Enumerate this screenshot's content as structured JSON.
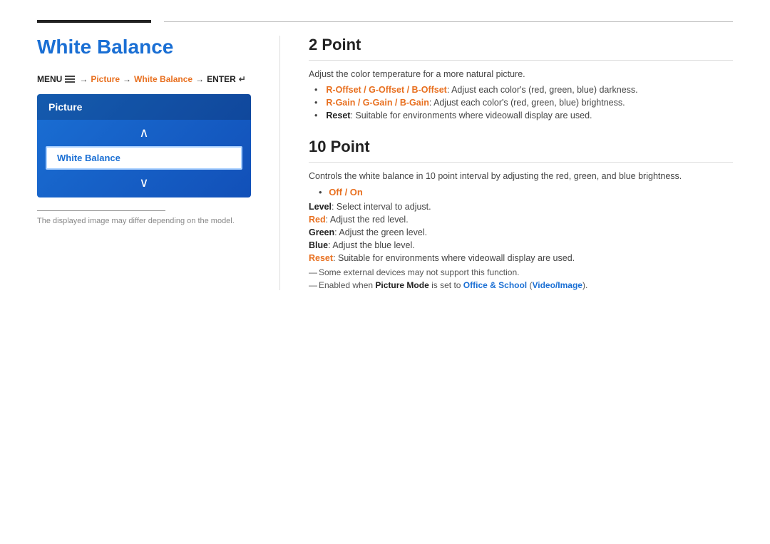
{
  "topbar": {
    "short_line": true,
    "long_line": true
  },
  "left": {
    "title": "White Balance",
    "menu_path": {
      "menu_label": "MENU",
      "arrow1": "→",
      "picture": "Picture",
      "arrow2": "→",
      "white_balance": "White Balance",
      "arrow3": "→",
      "enter": "ENTER"
    },
    "widget": {
      "header": "Picture",
      "up_arrow": "∧",
      "selected_item": "White Balance",
      "down_arrow": "∨"
    },
    "disclaimer_text": "The displayed image may differ depending on the model."
  },
  "right": {
    "section1": {
      "title": "2 Point",
      "desc": "Adjust the color temperature for a more natural picture.",
      "bullets": [
        {
          "bold_part": "R-Offset / G-Offset / B-Offset",
          "rest": ": Adjust each color's (red, green, blue) darkness.",
          "bold_type": "orange"
        },
        {
          "bold_part": "R-Gain / G-Gain / B-Gain",
          "rest": ": Adjust each color's (red, green, blue) brightness.",
          "bold_type": "orange"
        },
        {
          "bold_part": "Reset",
          "rest": ": Suitable for environments where videowall display are used.",
          "bold_type": "black"
        }
      ]
    },
    "section2": {
      "title": "10 Point",
      "desc": "Controls the white balance in 10 point interval by adjusting the red, green, and blue brightness.",
      "off_on": "Off / On",
      "items": [
        {
          "bold_part": "Level",
          "bold_type": "black",
          "rest": ": Select interval to adjust."
        },
        {
          "bold_part": "Red",
          "bold_type": "orange",
          "rest": ": Adjust the red level."
        },
        {
          "bold_part": "Green",
          "bold_type": "black",
          "rest": ": Adjust the green level."
        },
        {
          "bold_part": "Blue",
          "bold_type": "black",
          "rest": ": Adjust the blue level."
        },
        {
          "bold_part": "Reset",
          "bold_type": "orange",
          "rest": ": Suitable for environments where videowall display are used."
        }
      ],
      "note1": "Some external devices may not support this function.",
      "note2_before": "Enabled when ",
      "note2_bold1": "Picture Mode",
      "note2_mid": " is set to ",
      "note2_bold2": "Office & School",
      "note2_paren_open": " (",
      "note2_bold3": "Video/Image",
      "note2_paren_close": ").",
      "off_on_bullet": "• "
    }
  }
}
